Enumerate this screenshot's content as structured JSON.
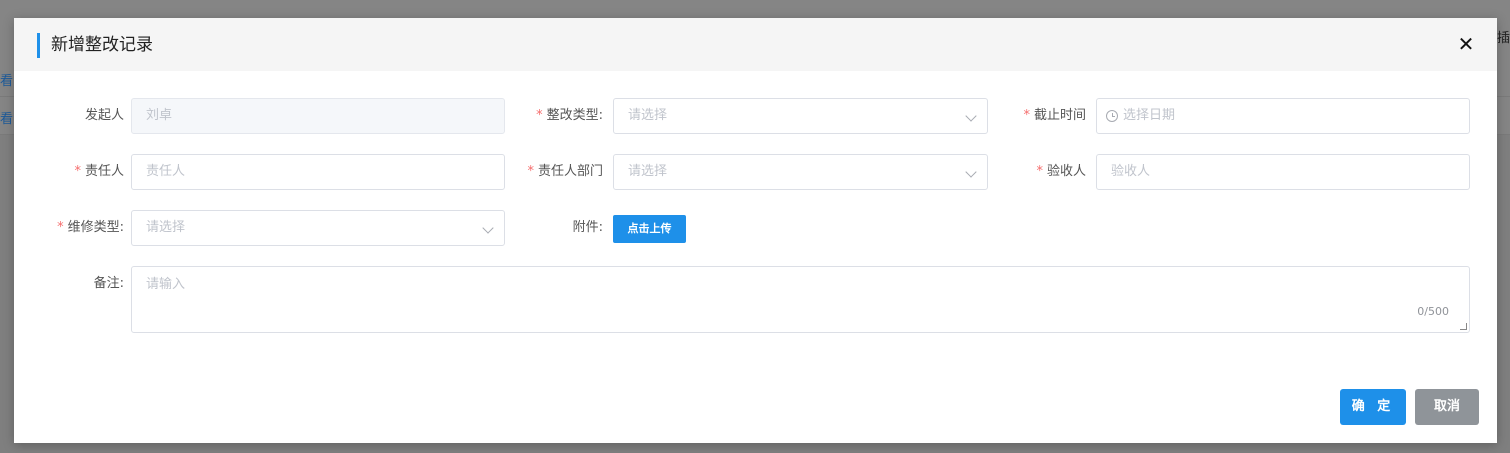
{
  "background": {
    "row_links": [
      "看",
      "看"
    ],
    "right_hint": "插"
  },
  "dialog": {
    "title": "新增整改记录",
    "close_icon": "close-icon"
  },
  "form": {
    "initiator": {
      "label": "发起人",
      "value": "刘卓",
      "required": false,
      "disabled": true
    },
    "rectify_type": {
      "label": "整改类型:",
      "placeholder": "请选择",
      "required": true
    },
    "deadline": {
      "label": "截止时间",
      "placeholder": "选择日期",
      "required": true,
      "icon": "clock-icon"
    },
    "responsible_person": {
      "label": "责任人",
      "placeholder": "责任人",
      "required": true
    },
    "responsible_dept": {
      "label": "责任人部门",
      "placeholder": "请选择",
      "required": true
    },
    "acceptor": {
      "label": "验收人",
      "placeholder": "验收人",
      "required": true
    },
    "repair_type": {
      "label": "维修类型:",
      "placeholder": "请选择",
      "required": true
    },
    "attachment": {
      "label": "附件:",
      "button_label": "点击上传"
    },
    "remark": {
      "label": "备注:",
      "placeholder": "请输入",
      "counter": "0/500"
    }
  },
  "footer": {
    "confirm_label": "确 定",
    "cancel_label": "取消"
  },
  "colors": {
    "primary": "#1e90e9",
    "required_star": "#f56c6c",
    "cancel": "#8f9499"
  }
}
